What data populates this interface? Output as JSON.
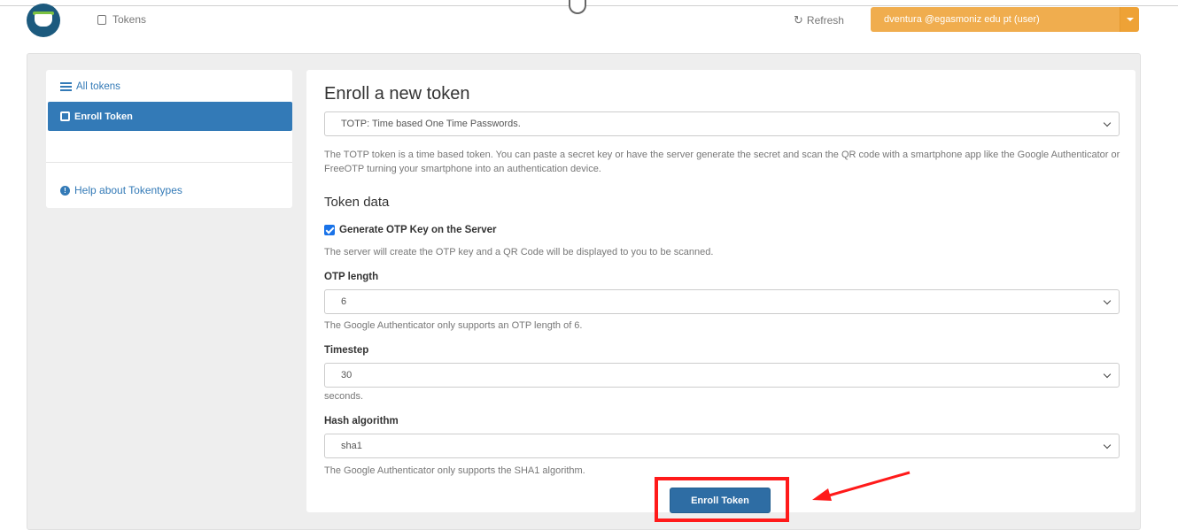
{
  "topbar": {
    "tokens_label": "Tokens",
    "refresh_label": "Refresh",
    "user_label": "dventura @egasmoniz edu pt (user)"
  },
  "sidebar": {
    "all_tokens": "All tokens",
    "enroll_token": "Enroll Token",
    "help": "Help about Tokentypes"
  },
  "form": {
    "title": "Enroll a new token",
    "token_type_value": "TOTP: Time based One Time Passwords.",
    "description": "The TOTP token is a time based token. You can paste a secret key or have the server generate the secret and scan the QR code with a smartphone app like the Google Authenticator or FreeOTP turning your smartphone into an authentication device.",
    "token_data_heading": "Token data",
    "generate_label": "Generate OTP Key on the Server",
    "generate_checked": true,
    "generate_help": "The server will create the OTP key and a QR Code will be displayed to you to be scanned.",
    "otp_length_label": "OTP length",
    "otp_length_value": "6",
    "otp_length_help": "The Google Authenticator only supports an OTP length of 6.",
    "timestep_label": "Timestep",
    "timestep_value": "30",
    "timestep_help": "seconds.",
    "hash_label": "Hash algorithm",
    "hash_value": "sha1",
    "hash_help": "The Google Authenticator only supports the SHA1 algorithm.",
    "enroll_button": "Enroll Token"
  },
  "colors": {
    "primary": "#337ab7",
    "user_button": "#f0ad4e",
    "annotation": "#ff1a1a"
  }
}
